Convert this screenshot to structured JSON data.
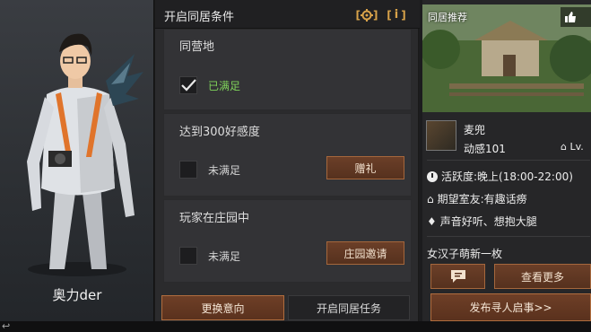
{
  "character": {
    "name": "奥力der"
  },
  "conditions_panel": {
    "title": "开启同居条件",
    "settings_icon": "gear-icon",
    "info_icon": "info-icon",
    "conditions": [
      {
        "label": "同营地",
        "status": "已满足",
        "met": true,
        "action": ""
      },
      {
        "label": "达到300好感度",
        "status": "未满足",
        "met": false,
        "action": "赠礼"
      },
      {
        "label": "玩家在庄园中",
        "status": "未满足",
        "met": false,
        "action": "庄园邀请"
      }
    ],
    "change_intent_label": "更换意向",
    "start_task_label": "开启同居任务"
  },
  "recommendation": {
    "title": "同居推荐",
    "like_icon": "thumbs-up-icon",
    "player_name": "麦兜",
    "player_subtitle": "动感101",
    "level_prefix": "Lv.",
    "active_time": "活跃度:晚上(18:00-22:00)",
    "expected_roommate": "期望室友:有趣话痨",
    "tags": "声音好听、想抱大腿",
    "description": "女汉子萌新一枚",
    "view_more_label": "查看更多",
    "post_label": "发布寻人启事>>"
  },
  "colors": {
    "accent_orange": "#d9a34a",
    "button_brown": "#5a311d",
    "met_green": "#7fd35a"
  }
}
